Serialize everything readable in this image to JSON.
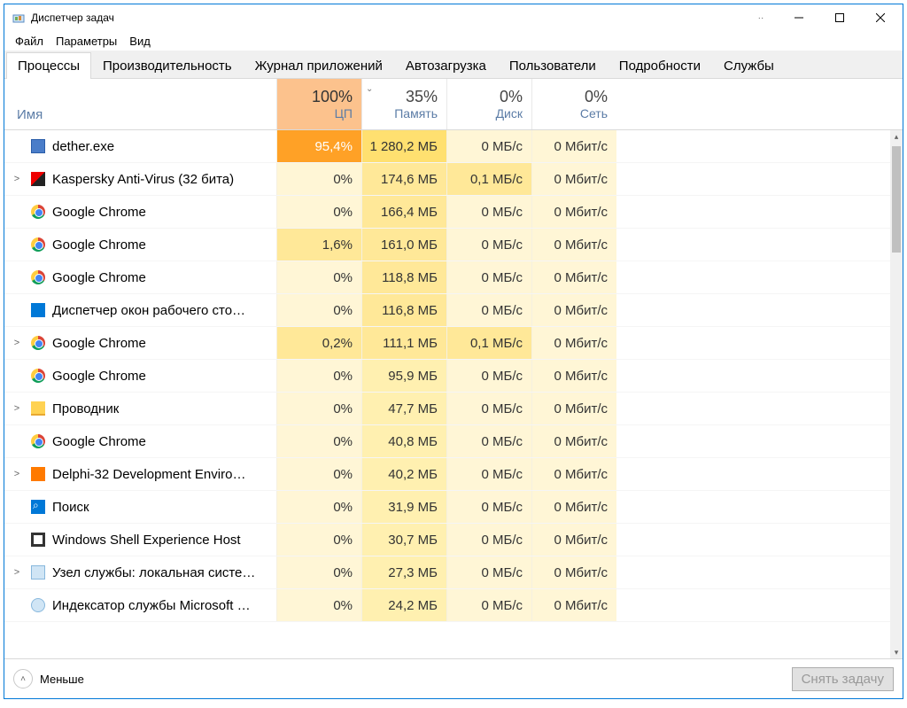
{
  "window": {
    "title": "Диспетчер задач"
  },
  "menu": [
    "Файл",
    "Параметры",
    "Вид"
  ],
  "tabs": [
    "Процессы",
    "Производительность",
    "Журнал приложений",
    "Автозагрузка",
    "Пользователи",
    "Подробности",
    "Службы"
  ],
  "activeTab": 0,
  "columns": {
    "name": "Имя",
    "cpu": {
      "pct": "100%",
      "label": "ЦП"
    },
    "mem": {
      "pct": "35%",
      "label": "Память"
    },
    "disk": {
      "pct": "0%",
      "label": "Диск"
    },
    "net": {
      "pct": "0%",
      "label": "Сеть"
    }
  },
  "rows": [
    {
      "exp": "",
      "icon": "ic-generic",
      "name": "dether.exe",
      "cpu": "95,4%",
      "mem": "1 280,2 МБ",
      "disk": "0 МБ/с",
      "net": "0 Мбит/с",
      "cpuHeat": "hi",
      "memHeat": "hi"
    },
    {
      "exp": ">",
      "icon": "ic-kav",
      "name": "Kaspersky Anti-Virus (32 бита)",
      "cpu": "0%",
      "mem": "174,6 МБ",
      "disk": "0,1 МБ/с",
      "net": "0 Мбит/с",
      "memHeat": "m",
      "diskHeat": "m"
    },
    {
      "exp": "",
      "icon": "ic-chrome",
      "name": "Google Chrome",
      "cpu": "0%",
      "mem": "166,4 МБ",
      "disk": "0 МБ/с",
      "net": "0 Мбит/с",
      "memHeat": "m"
    },
    {
      "exp": "",
      "icon": "ic-chrome",
      "name": "Google Chrome",
      "cpu": "1,6%",
      "mem": "161,0 МБ",
      "disk": "0 МБ/с",
      "net": "0 Мбит/с",
      "cpuHeat": "m",
      "memHeat": "m"
    },
    {
      "exp": "",
      "icon": "ic-chrome",
      "name": "Google Chrome",
      "cpu": "0%",
      "mem": "118,8 МБ",
      "disk": "0 МБ/с",
      "net": "0 Мбит/с",
      "memHeat": "m"
    },
    {
      "exp": "",
      "icon": "ic-win",
      "name": "Диспетчер окон рабочего сто…",
      "cpu": "0%",
      "mem": "116,8 МБ",
      "disk": "0 МБ/с",
      "net": "0 Мбит/с",
      "memHeat": "m"
    },
    {
      "exp": ">",
      "icon": "ic-chrome",
      "name": "Google Chrome",
      "cpu": "0,2%",
      "mem": "111,1 МБ",
      "disk": "0,1 МБ/с",
      "net": "0 Мбит/с",
      "cpuHeat": "m",
      "memHeat": "m",
      "diskHeat": "m"
    },
    {
      "exp": "",
      "icon": "ic-chrome",
      "name": "Google Chrome",
      "cpu": "0%",
      "mem": "95,9 МБ",
      "disk": "0 МБ/с",
      "net": "0 Мбит/с",
      "memHeat": "l"
    },
    {
      "exp": ">",
      "icon": "ic-folder",
      "name": "Проводник",
      "cpu": "0%",
      "mem": "47,7 МБ",
      "disk": "0 МБ/с",
      "net": "0 Мбит/с",
      "memHeat": "l"
    },
    {
      "exp": "",
      "icon": "ic-chrome",
      "name": "Google Chrome",
      "cpu": "0%",
      "mem": "40,8 МБ",
      "disk": "0 МБ/с",
      "net": "0 Мбит/с",
      "memHeat": "l"
    },
    {
      "exp": ">",
      "icon": "ic-delphi",
      "name": "Delphi-32 Development Enviro…",
      "cpu": "0%",
      "mem": "40,2 МБ",
      "disk": "0 МБ/с",
      "net": "0 Мбит/с",
      "memHeat": "l"
    },
    {
      "exp": "",
      "icon": "ic-search",
      "name": "Поиск",
      "cpu": "0%",
      "mem": "31,9 МБ",
      "disk": "0 МБ/с",
      "net": "0 Мбит/с",
      "memHeat": "l"
    },
    {
      "exp": "",
      "icon": "ic-shell",
      "name": "Windows Shell Experience Host",
      "cpu": "0%",
      "mem": "30,7 МБ",
      "disk": "0 МБ/с",
      "net": "0 Мбит/с",
      "memHeat": "l"
    },
    {
      "exp": ">",
      "icon": "ic-svc",
      "name": "Узел службы: локальная систе…",
      "cpu": "0%",
      "mem": "27,3 МБ",
      "disk": "0 МБ/с",
      "net": "0 Мбит/с",
      "memHeat": "l"
    },
    {
      "exp": "",
      "icon": "ic-idx",
      "name": "Индексатор службы Microsoft …",
      "cpu": "0%",
      "mem": "24,2 МБ",
      "disk": "0 МБ/с",
      "net": "0 Мбит/с",
      "memHeat": "l"
    }
  ],
  "footer": {
    "less": "Меньше",
    "endTask": "Снять задачу"
  }
}
